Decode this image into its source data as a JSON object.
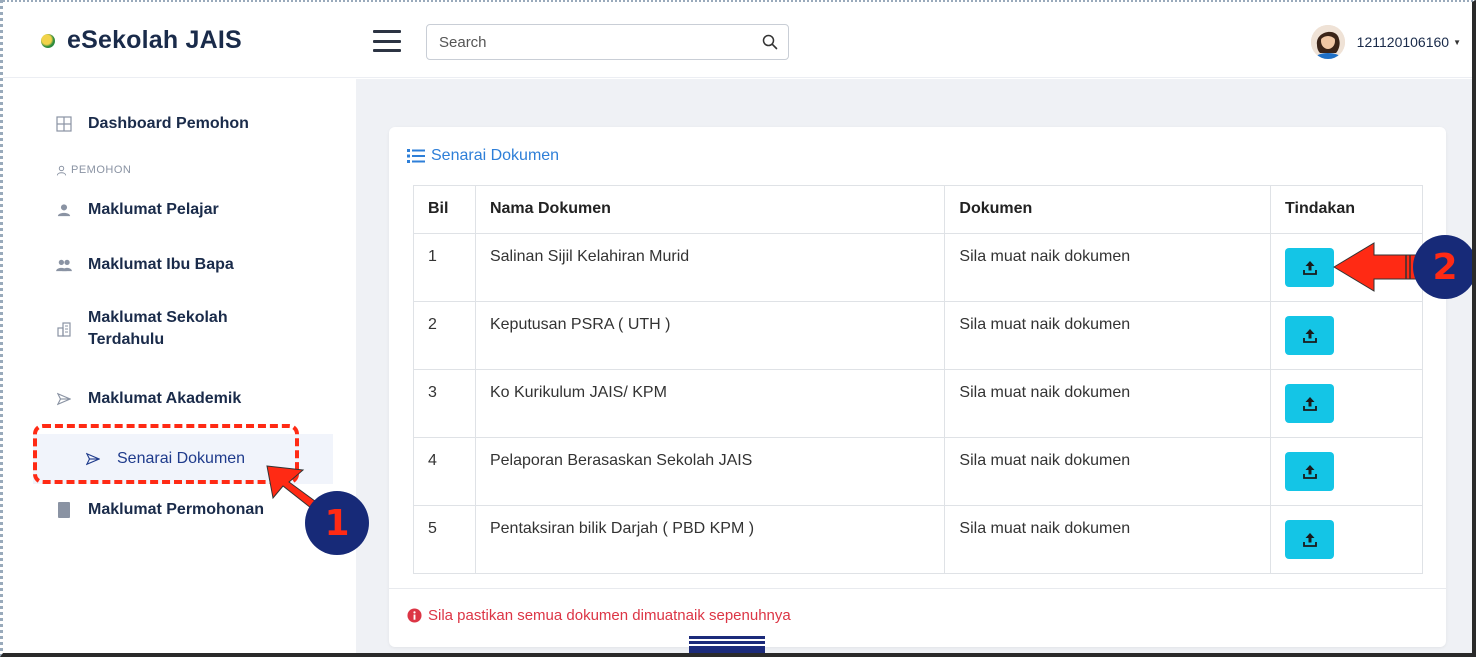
{
  "header": {
    "brand": "eSekolah JAIS",
    "search_placeholder": "Search",
    "user_id": "121120106160"
  },
  "sidebar": {
    "section_label": "PEMOHON",
    "items": [
      {
        "label": "Dashboard Pemohon",
        "icon": "grid-icon"
      },
      {
        "label": "Maklumat Pelajar",
        "icon": "user-icon"
      },
      {
        "label": "Maklumat Ibu Bapa",
        "icon": "users-icon"
      },
      {
        "label": "Maklumat Sekolah Terdahulu",
        "icon": "building-icon"
      },
      {
        "label": "Maklumat Akademik",
        "icon": "send-icon"
      },
      {
        "label": "Senarai Dokumen",
        "icon": "send-icon"
      },
      {
        "label": "Maklumat Permohonan",
        "icon": "document-icon"
      }
    ]
  },
  "card": {
    "title": "Senarai Dokumen",
    "columns": [
      "Bil",
      "Nama Dokumen",
      "Dokumen",
      "Tindakan"
    ],
    "rows": [
      {
        "bil": "1",
        "nama": "Salinan Sijil Kelahiran Murid",
        "status": "Sila muat naik dokumen"
      },
      {
        "bil": "2",
        "nama": "Keputusan PSRA ( UTH )",
        "status": "Sila muat naik dokumen"
      },
      {
        "bil": "3",
        "nama": "Ko Kurikulum JAIS/ KPM",
        "status": "Sila muat naik dokumen"
      },
      {
        "bil": "4",
        "nama": "Pelaporan Berasaskan Sekolah JAIS",
        "status": "Sila muat naik dokumen"
      },
      {
        "bil": "5",
        "nama": "Pentaksiran bilik Darjah ( PBD KPM )",
        "status": "Sila muat naik dokumen"
      }
    ],
    "footer_note": "Sila pastikan semua dokumen dimuatnaik sepenuhnya"
  },
  "annotations": {
    "step1": "1",
    "step2": "2"
  },
  "colors": {
    "upload_button": "#14c5e6",
    "status_red": "#dc3545",
    "link_blue": "#2e7fd8",
    "annotation_red": "#ff2a14",
    "annotation_navy": "#172a78"
  }
}
